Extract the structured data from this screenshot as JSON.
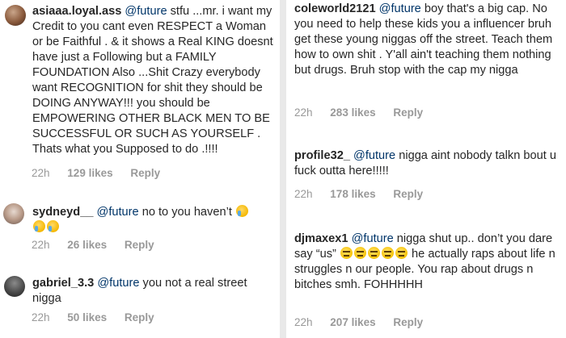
{
  "mention": "@future",
  "left": {
    "comments": [
      {
        "username": "asiaaa.loyal.ass",
        "text": "stfu ...mr. i want my Credit to you cant even RESPECT a Woman or be Faithful . & it shows a Real KING doesnt have just a Following but a FAMILY FOUNDATION Also ...Shit Crazy everybody want RECOGNITION for shit they should be DOING ANYWAY!!! you should be EMPOWERING OTHER BLACK MEN TO BE SUCCESSFUL OR SUCH AS YOURSELF . Thats what you Supposed to do .!!!!",
        "time": "22h",
        "likes": "129 likes",
        "reply": "Reply"
      },
      {
        "username": "sydneyd__",
        "text": "no to you haven’t",
        "emoji": [
          "face-with-tears-of-joy",
          "face-with-tears-of-joy",
          "face-with-tears-of-joy"
        ],
        "time": "22h",
        "likes": "26 likes",
        "reply": "Reply"
      },
      {
        "username": "gabriel_3.3",
        "text": "you not a real street nigga",
        "time": "22h",
        "likes": "50 likes",
        "reply": "Reply"
      }
    ]
  },
  "right": {
    "comments": [
      {
        "username": "coleworld2121",
        "text": "boy that's a big cap. No you need to help these kids you a influencer bruh get these young niggas off the street. Teach them how to own shit . Y'all ain't teaching them nothing but drugs. Bruh stop with the cap my nigga",
        "time": "22h",
        "likes": "283 likes",
        "reply": "Reply"
      },
      {
        "username": "profile32_",
        "text": "nigga aint nobody talkn bout u fuck outta here!!!!!",
        "time": "22h",
        "likes": "178 likes",
        "reply": "Reply"
      },
      {
        "username": "djmaxex1",
        "text_a": "nigga shut up.. don’t you dare say “us”",
        "text_b": "he actually raps about life n struggles n our people. You rap about drugs n bitches smh. FOHHHHH",
        "emoji": [
          "expressionless-face",
          "expressionless-face",
          "expressionless-face",
          "expressionless-face",
          "expressionless-face"
        ],
        "time": "22h",
        "likes": "207 likes",
        "reply": "Reply"
      }
    ]
  },
  "colors": {
    "username": "#262626",
    "mention": "#003569",
    "meta": "#999999",
    "divider": "#e9e9e9"
  }
}
